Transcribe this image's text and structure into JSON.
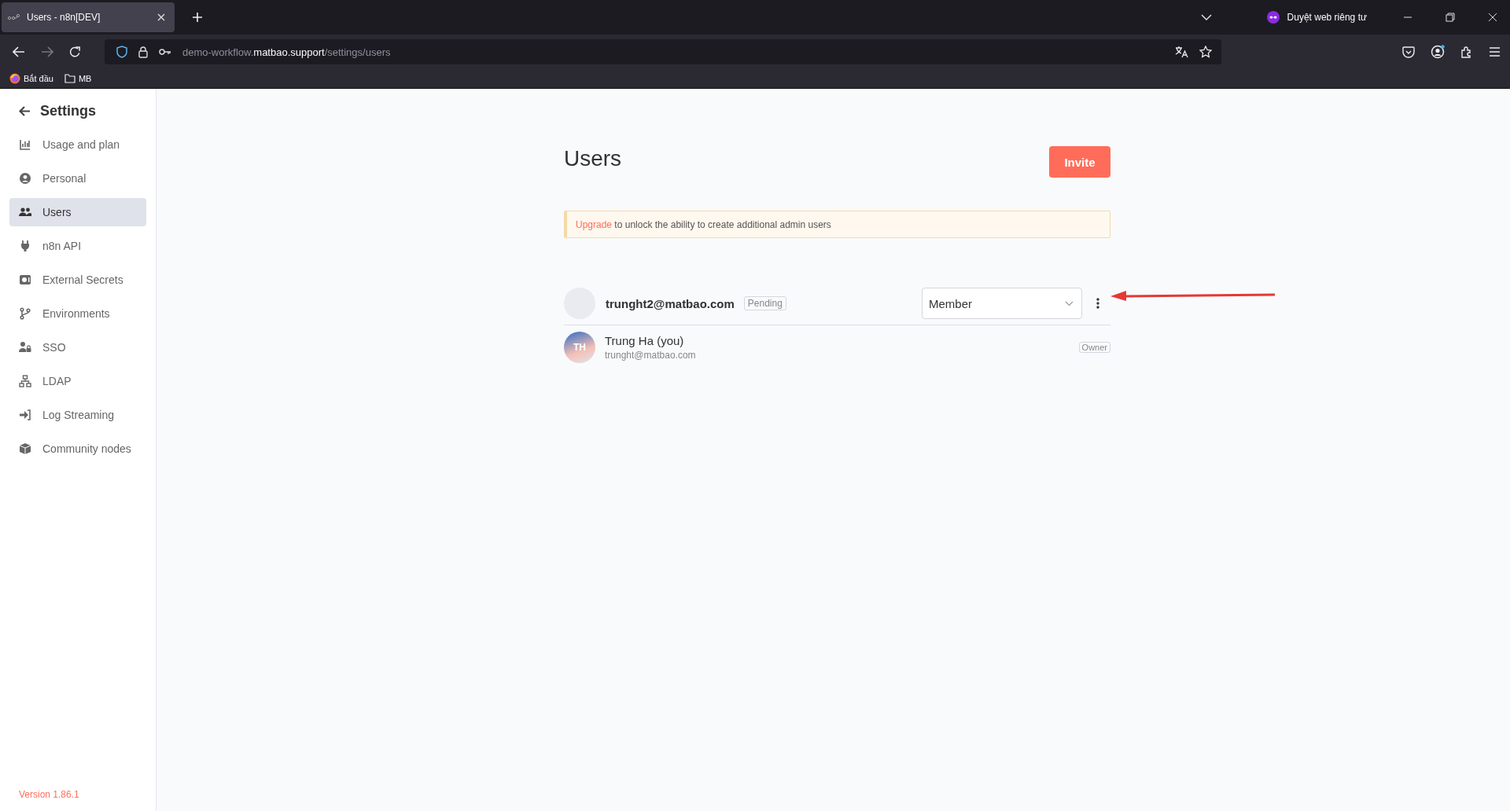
{
  "browser": {
    "tab": {
      "title": "Users - n8n[DEV]",
      "selected": true
    },
    "url": {
      "subdomain": "demo-workflow.",
      "domain": "matbao.support",
      "path": "/settings/users"
    },
    "private_label": "Duyệt web riêng tư",
    "bookmarks": [
      {
        "label": "Bắt đầu",
        "kind": "site"
      },
      {
        "label": "MB",
        "kind": "folder"
      }
    ]
  },
  "sidebar": {
    "title": "Settings",
    "items": [
      {
        "label": "Usage and plan",
        "selected": false
      },
      {
        "label": "Personal",
        "selected": false
      },
      {
        "label": "Users",
        "selected": true
      },
      {
        "label": "n8n API",
        "selected": false
      },
      {
        "label": "External Secrets",
        "selected": false
      },
      {
        "label": "Environments",
        "selected": false
      },
      {
        "label": "SSO",
        "selected": false
      },
      {
        "label": "LDAP",
        "selected": false
      },
      {
        "label": "Log Streaming",
        "selected": false
      },
      {
        "label": "Community nodes",
        "selected": false
      }
    ],
    "version": "Version 1.86.1"
  },
  "page": {
    "title": "Users",
    "invite_button": "Invite",
    "banner": {
      "link": "Upgrade",
      "text": "to unlock the ability to create additional admin users"
    },
    "users": [
      {
        "kind": "pending",
        "email": "trunght2@matbao.com",
        "status": "Pending",
        "role": "Member"
      },
      {
        "kind": "active",
        "initials": "TH",
        "name": "Trung Ha (you)",
        "email": "trunght@matbao.com",
        "role": "Owner"
      }
    ]
  }
}
